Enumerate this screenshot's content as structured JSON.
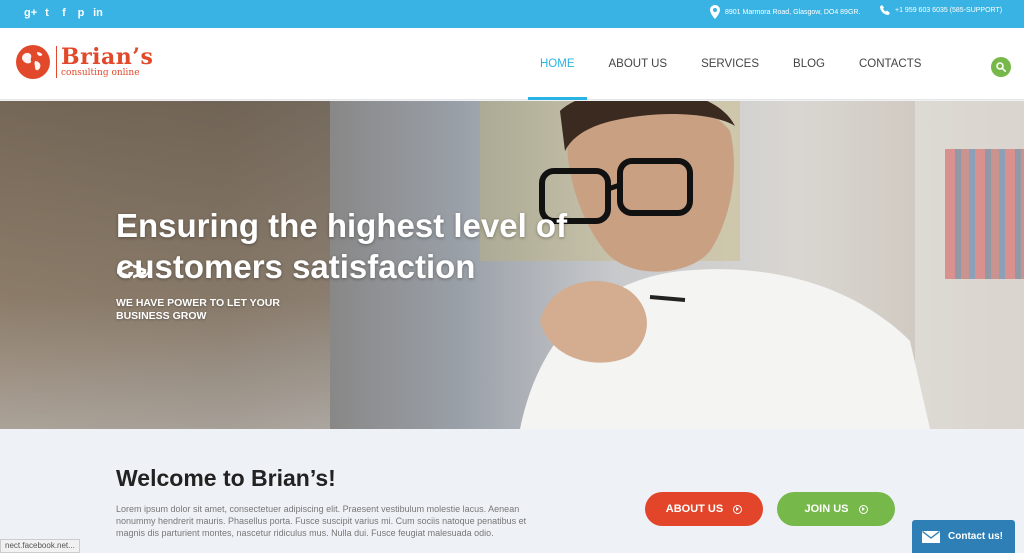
{
  "colors": {
    "topbar": "#39b3e3",
    "brand": "#e2492a",
    "accent": "#29b3e3",
    "green": "#77b84a",
    "widget": "#2f7fb7"
  },
  "topbar": {
    "social": [
      {
        "icon": "google-plus-icon",
        "glyph": "g+"
      },
      {
        "icon": "twitter-icon",
        "glyph": "t"
      },
      {
        "icon": "facebook-icon",
        "glyph": "f"
      },
      {
        "icon": "pinterest-icon",
        "glyph": "p"
      },
      {
        "icon": "linkedin-icon",
        "glyph": "in"
      }
    ],
    "address": "8901 Marmora Road, Glasgow, DO4 89GR.",
    "phone": "+1 959 603 6035 (585-SUPPORT)"
  },
  "header": {
    "logo_name": "Brian’s",
    "logo_tagline": "consulting online",
    "nav": [
      {
        "label": "HOME",
        "active": true
      },
      {
        "label": "ABOUT US",
        "active": false
      },
      {
        "label": "SERVICES",
        "active": false
      },
      {
        "label": "BLOG",
        "active": false
      },
      {
        "label": "CONTACTS",
        "active": false
      }
    ]
  },
  "hero": {
    "title": "Ensuring the highest level of customers satisfaction",
    "subtitle": "WE HAVE POWER TO LET YOUR BUSINESS GROW",
    "prev": "<",
    "next": ">"
  },
  "welcome": {
    "title": "Welcome to Brian’s!",
    "body": "Lorem ipsum dolor sit amet, consectetuer adipiscing elit. Praesent vestibulum molestie lacus. Aenean nonummy hendrerit mauris. Phasellus porta. Fusce suscipit varius mi. Cum sociis natoque penatibus et magnis dis parturient montes, nascetur ridiculus mus. Nulla dui. Fusce feugiat malesuada odio.",
    "about_button": "ABOUT US",
    "join_button": "JOIN US"
  },
  "status_url": "nect.facebook.net...",
  "contact_widget": "Contact us!"
}
